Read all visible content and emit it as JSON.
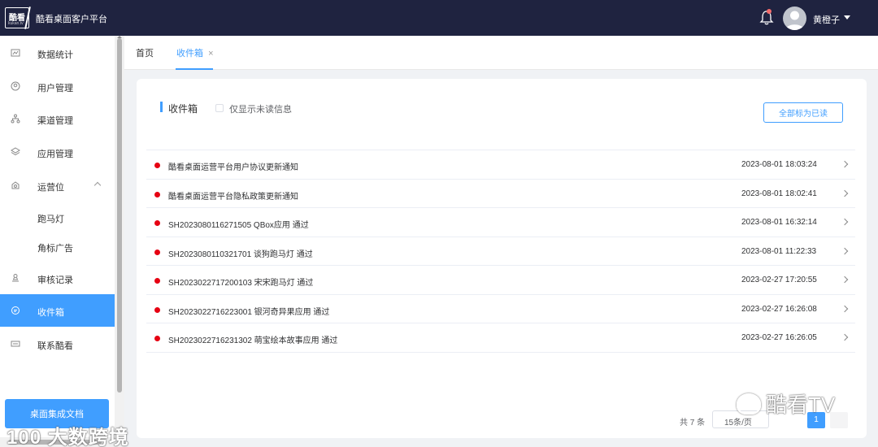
{
  "header": {
    "logo_text": "酷看",
    "logo_sub": "kukan.tv",
    "app_title": "酷看桌面客户平台",
    "user_name": "黄橙子",
    "notification_has_unread": true
  },
  "sidebar": {
    "items": [
      {
        "label": "数据统计",
        "icon": "chart-icon"
      },
      {
        "label": "用户管理",
        "icon": "user-icon"
      },
      {
        "label": "渠道管理",
        "icon": "channel-tree-icon"
      },
      {
        "label": "应用管理",
        "icon": "layers-icon"
      },
      {
        "label": "运营位",
        "icon": "operation-icon",
        "expanded": true
      },
      {
        "label": "跑马灯",
        "icon": ""
      },
      {
        "label": "角标广告",
        "icon": ""
      },
      {
        "label": "审核记录",
        "icon": "audit-icon"
      },
      {
        "label": "收件箱",
        "icon": "message-icon",
        "active": true
      },
      {
        "label": "联系酷看",
        "icon": "contact-icon"
      }
    ],
    "doc_button": "桌面集成文档"
  },
  "tabs": [
    {
      "label": "首页",
      "active": false
    },
    {
      "label": "收件箱",
      "active": true,
      "close": "×"
    }
  ],
  "inbox": {
    "title": "收件箱",
    "unread_only_label": "仅显示未读信息",
    "unread_only_checked": false,
    "mark_all_read": "全部标为已读",
    "messages": [
      {
        "text": "酷看桌面运营平台用户协议更新通知",
        "time": "2023-08-01 18:03:24",
        "unread": true
      },
      {
        "text": "酷看桌面运营平台隐私政策更新通知",
        "time": "2023-08-01 18:02:41",
        "unread": true
      },
      {
        "text": "SH2023080116271505 QBox应用 通过",
        "time": "2023-08-01 16:32:14",
        "unread": true
      },
      {
        "text": "SH2023080110321701 谈狗跑马灯 通过",
        "time": "2023-08-01 11:22:33",
        "unread": true
      },
      {
        "text": "SH2023022717200103 宋宋跑马灯 通过",
        "time": "2023-02-27 17:20:55",
        "unread": true
      },
      {
        "text": "SH2023022716223001 银河奇异果应用 通过",
        "time": "2023-02-27 16:26:08",
        "unread": true
      },
      {
        "text": "SH2023022716231302 萌宝绘本故事应用 通过",
        "time": "2023-02-27 16:26:05",
        "unread": true
      }
    ]
  },
  "pagination": {
    "total": "共 7 条",
    "page_size": "15条/页",
    "current_page": "1"
  },
  "watermarks": {
    "right": "酷看TV",
    "left": "100 大数跨境"
  },
  "colors": {
    "header_bg": "#1f2340",
    "accent": "#409eff",
    "unread_dot": "#e60012"
  }
}
